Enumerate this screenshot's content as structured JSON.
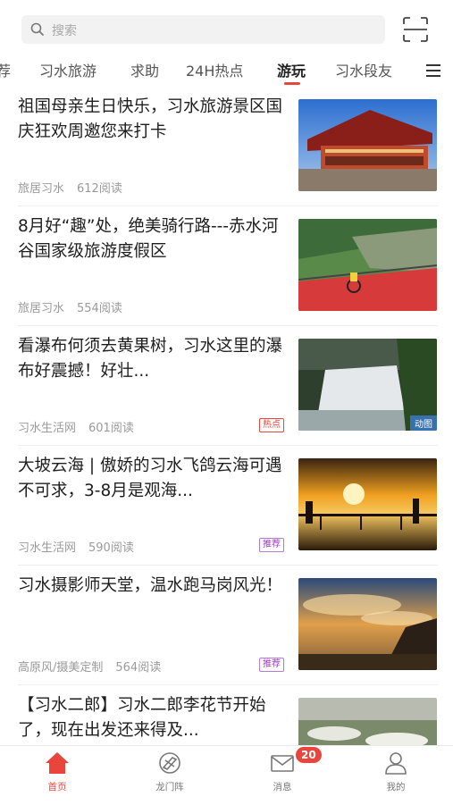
{
  "search": {
    "placeholder": "搜索"
  },
  "tabs": [
    {
      "label": "荐"
    },
    {
      "label": "习水旅游"
    },
    {
      "label": "求助"
    },
    {
      "label": "24H热点"
    },
    {
      "label": "游玩"
    },
    {
      "label": "习水段友"
    }
  ],
  "active_tab": "游玩",
  "articles": [
    {
      "title": "祖国母亲生日快乐，习水旅游景区国庆狂欢周邀您来打卡",
      "source": "旅居习水",
      "reads": "612阅读",
      "badge": "",
      "thumb_tag": ""
    },
    {
      "title": "8月好“趣”处，绝美骑行路---赤水河谷国家级旅游度假区",
      "source": "旅居习水",
      "reads": "554阅读",
      "badge": "",
      "thumb_tag": ""
    },
    {
      "title": "看瀑布何须去黄果树，习水这里的瀑布好震撼！好壮...",
      "source": "习水生活网",
      "reads": "601阅读",
      "badge": "热点",
      "thumb_tag": "动图"
    },
    {
      "title": "大坡云海 | 傲娇的习水飞鸽云海可遇不可求，3-8月是观海...",
      "source": "习水生活网",
      "reads": "590阅读",
      "badge": "推荐",
      "thumb_tag": ""
    },
    {
      "title": "习水摄影师天堂，温水跑马岗风光！",
      "source": "高原风/摄美定制",
      "reads": "564阅读",
      "badge": "推荐",
      "thumb_tag": ""
    },
    {
      "title": "【习水二郎】习水二郎李花节开始了，现在出发还来得及...",
      "source": "",
      "reads": "",
      "badge": "",
      "thumb_tag": ""
    }
  ],
  "bottom_nav": [
    {
      "label": "首页",
      "icon": "home-icon"
    },
    {
      "label": "龙门阵",
      "icon": "compass-icon"
    },
    {
      "label": "消息",
      "icon": "mail-icon"
    },
    {
      "label": "我的",
      "icon": "user-icon"
    }
  ],
  "message_count": "20",
  "colors": {
    "accent": "#e8463d",
    "recommend": "#9b3fc3"
  }
}
